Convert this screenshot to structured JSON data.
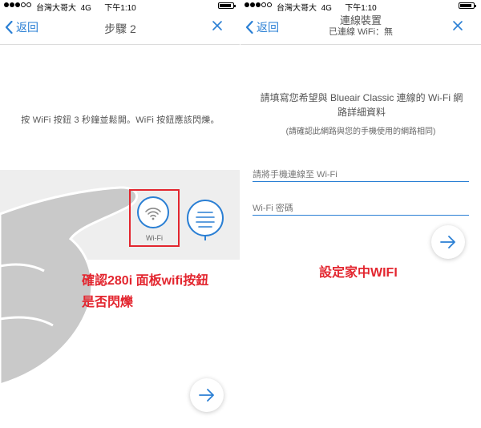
{
  "status_bar": {
    "carrier": "台灣大哥大",
    "network": "4G",
    "time": "下午1:10"
  },
  "left_screen": {
    "back_label": "返回",
    "title": "步驟 2",
    "instruction": "按 WiFi 按鈕 3 秒鐘並鬆開。WiFi 按鈕應該閃爍。",
    "wifi_button_label": "Wi-Fi",
    "annotation_line1": "確認280i 面板wifi按鈕",
    "annotation_line2": "是否閃爍"
  },
  "right_screen": {
    "back_label": "返回",
    "title": "連線裝置",
    "subtitle": "已連線 WiFi：無",
    "prompt": "請填寫您希望與 Blueair Classic 連線的 Wi-Fi 網路詳細資料",
    "hint": "(請確認此網路與您的手機使用的網路相同)",
    "ssid_placeholder": "請將手機連線至 Wi-Fi",
    "password_placeholder": "Wi-Fi 密碼",
    "annotation": "設定家中WIFI"
  },
  "colors": {
    "accent": "#2a7fd4",
    "annotation": "#e3262f",
    "panel": "#eeeeee",
    "hand": "#c9c9c9"
  },
  "icons": [
    "back-chevron-icon",
    "close-icon",
    "wifi-icon",
    "menu-icon",
    "arrow-right-icon"
  ]
}
